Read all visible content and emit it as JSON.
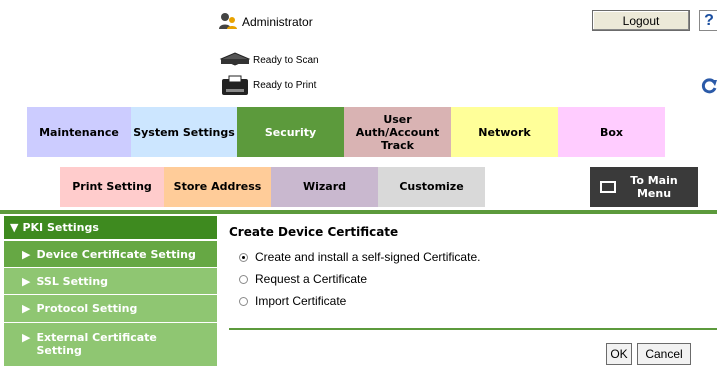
{
  "header": {
    "user_label": "Administrator",
    "logout_label": "Logout",
    "help_label": "?",
    "scan_status": "Ready to Scan",
    "print_status": "Ready to Print"
  },
  "tabs_row1": [
    {
      "label": "Maintenance",
      "color": "#ccccff"
    },
    {
      "label": "System Settings",
      "color": "#cce6ff"
    },
    {
      "label": "Security",
      "color": "#5c9a3c",
      "active": true
    },
    {
      "label": "User Auth/Account Track",
      "color": "#d9b3b3"
    },
    {
      "label": "Network",
      "color": "#ffff99"
    },
    {
      "label": "Box",
      "color": "#ffccff"
    }
  ],
  "tabs_row2": [
    {
      "label": "Print Setting",
      "color": "#ffcccc"
    },
    {
      "label": "Store Address",
      "color": "#ffcc99"
    },
    {
      "label": "Wizard",
      "color": "#c9b8cf"
    },
    {
      "label": "Customize",
      "color": "#d9d9d9"
    }
  ],
  "main_menu_label": "To Main Menu",
  "sidebar": {
    "header": "PKI Settings",
    "items": [
      {
        "label": "Device Certificate Setting",
        "active": true
      },
      {
        "label": "SSL Setting"
      },
      {
        "label": "Protocol Setting"
      },
      {
        "label": "External Certificate Setting"
      }
    ]
  },
  "content": {
    "title": "Create Device Certificate",
    "options": [
      {
        "label": "Create and install a self-signed Certificate.",
        "selected": true
      },
      {
        "label": "Request a Certificate",
        "selected": false
      },
      {
        "label": "Import Certificate",
        "selected": false
      }
    ],
    "ok_label": "OK",
    "cancel_label": "Cancel"
  },
  "colors": {
    "accent_green": "#5c9a3c",
    "sidebar_green": "#8fc672",
    "sidebar_header": "#3e8a1f"
  }
}
